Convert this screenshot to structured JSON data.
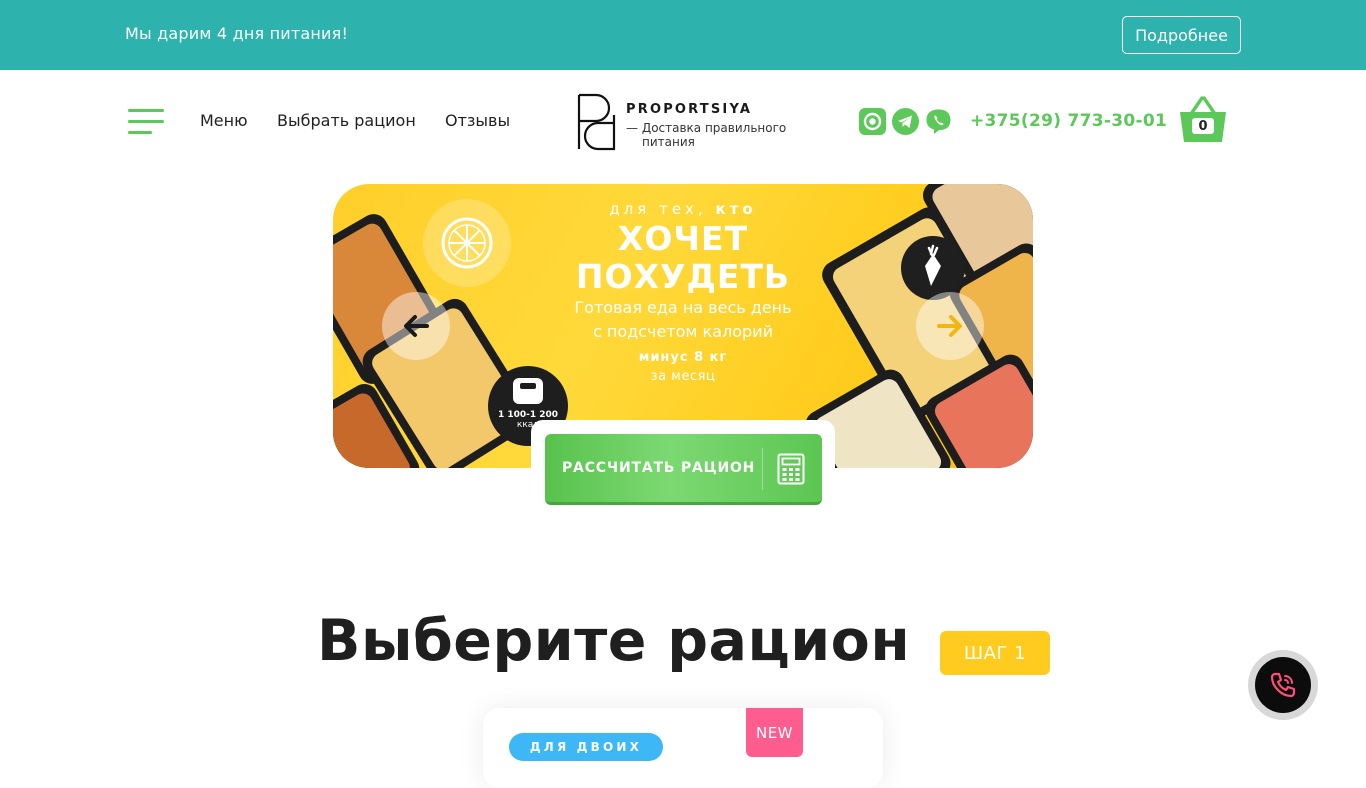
{
  "promo": {
    "text": "Мы дарим 4 дня питания!",
    "button_label": "Подробнее"
  },
  "header": {
    "nav": {
      "menu": "Меню",
      "choose_ration": "Выбрать рацион",
      "reviews": "Отзывы"
    },
    "logo": {
      "name": "PROPORTSIYA",
      "tagline_line1": "— Доставка правильного",
      "tagline_line2": "питания"
    },
    "social": [
      "instagram-icon",
      "telegram-icon",
      "viber-icon"
    ],
    "phone": "+375(29) 773-30-01",
    "cart_count": "0"
  },
  "banner": {
    "for_prefix": "для тех,",
    "for_bold": "кто",
    "headline_line1": "ХОЧЕТ",
    "headline_line2": "ПОХУДЕТЬ",
    "sub_line1": "Готовая еда на весь день",
    "sub_line2": "с подсчетом калорий",
    "minus": "минус 8 кг",
    "period": "за месяц",
    "kcal_range": "1 100-1 200",
    "kcal_unit": "ккал"
  },
  "cta": {
    "label": "РАССЧИТАТЬ РАЦИОН"
  },
  "section": {
    "title": "Выберите рацион",
    "step": "ШАГ 1"
  },
  "card": {
    "tag": "ДЛЯ ДВОИХ",
    "new_badge": "NEW"
  },
  "colors": {
    "teal": "#2db2ae",
    "green": "#5cc85a",
    "yellow": "#ffcb1f",
    "blue": "#3db7f5",
    "pink": "#ff5d8f"
  }
}
